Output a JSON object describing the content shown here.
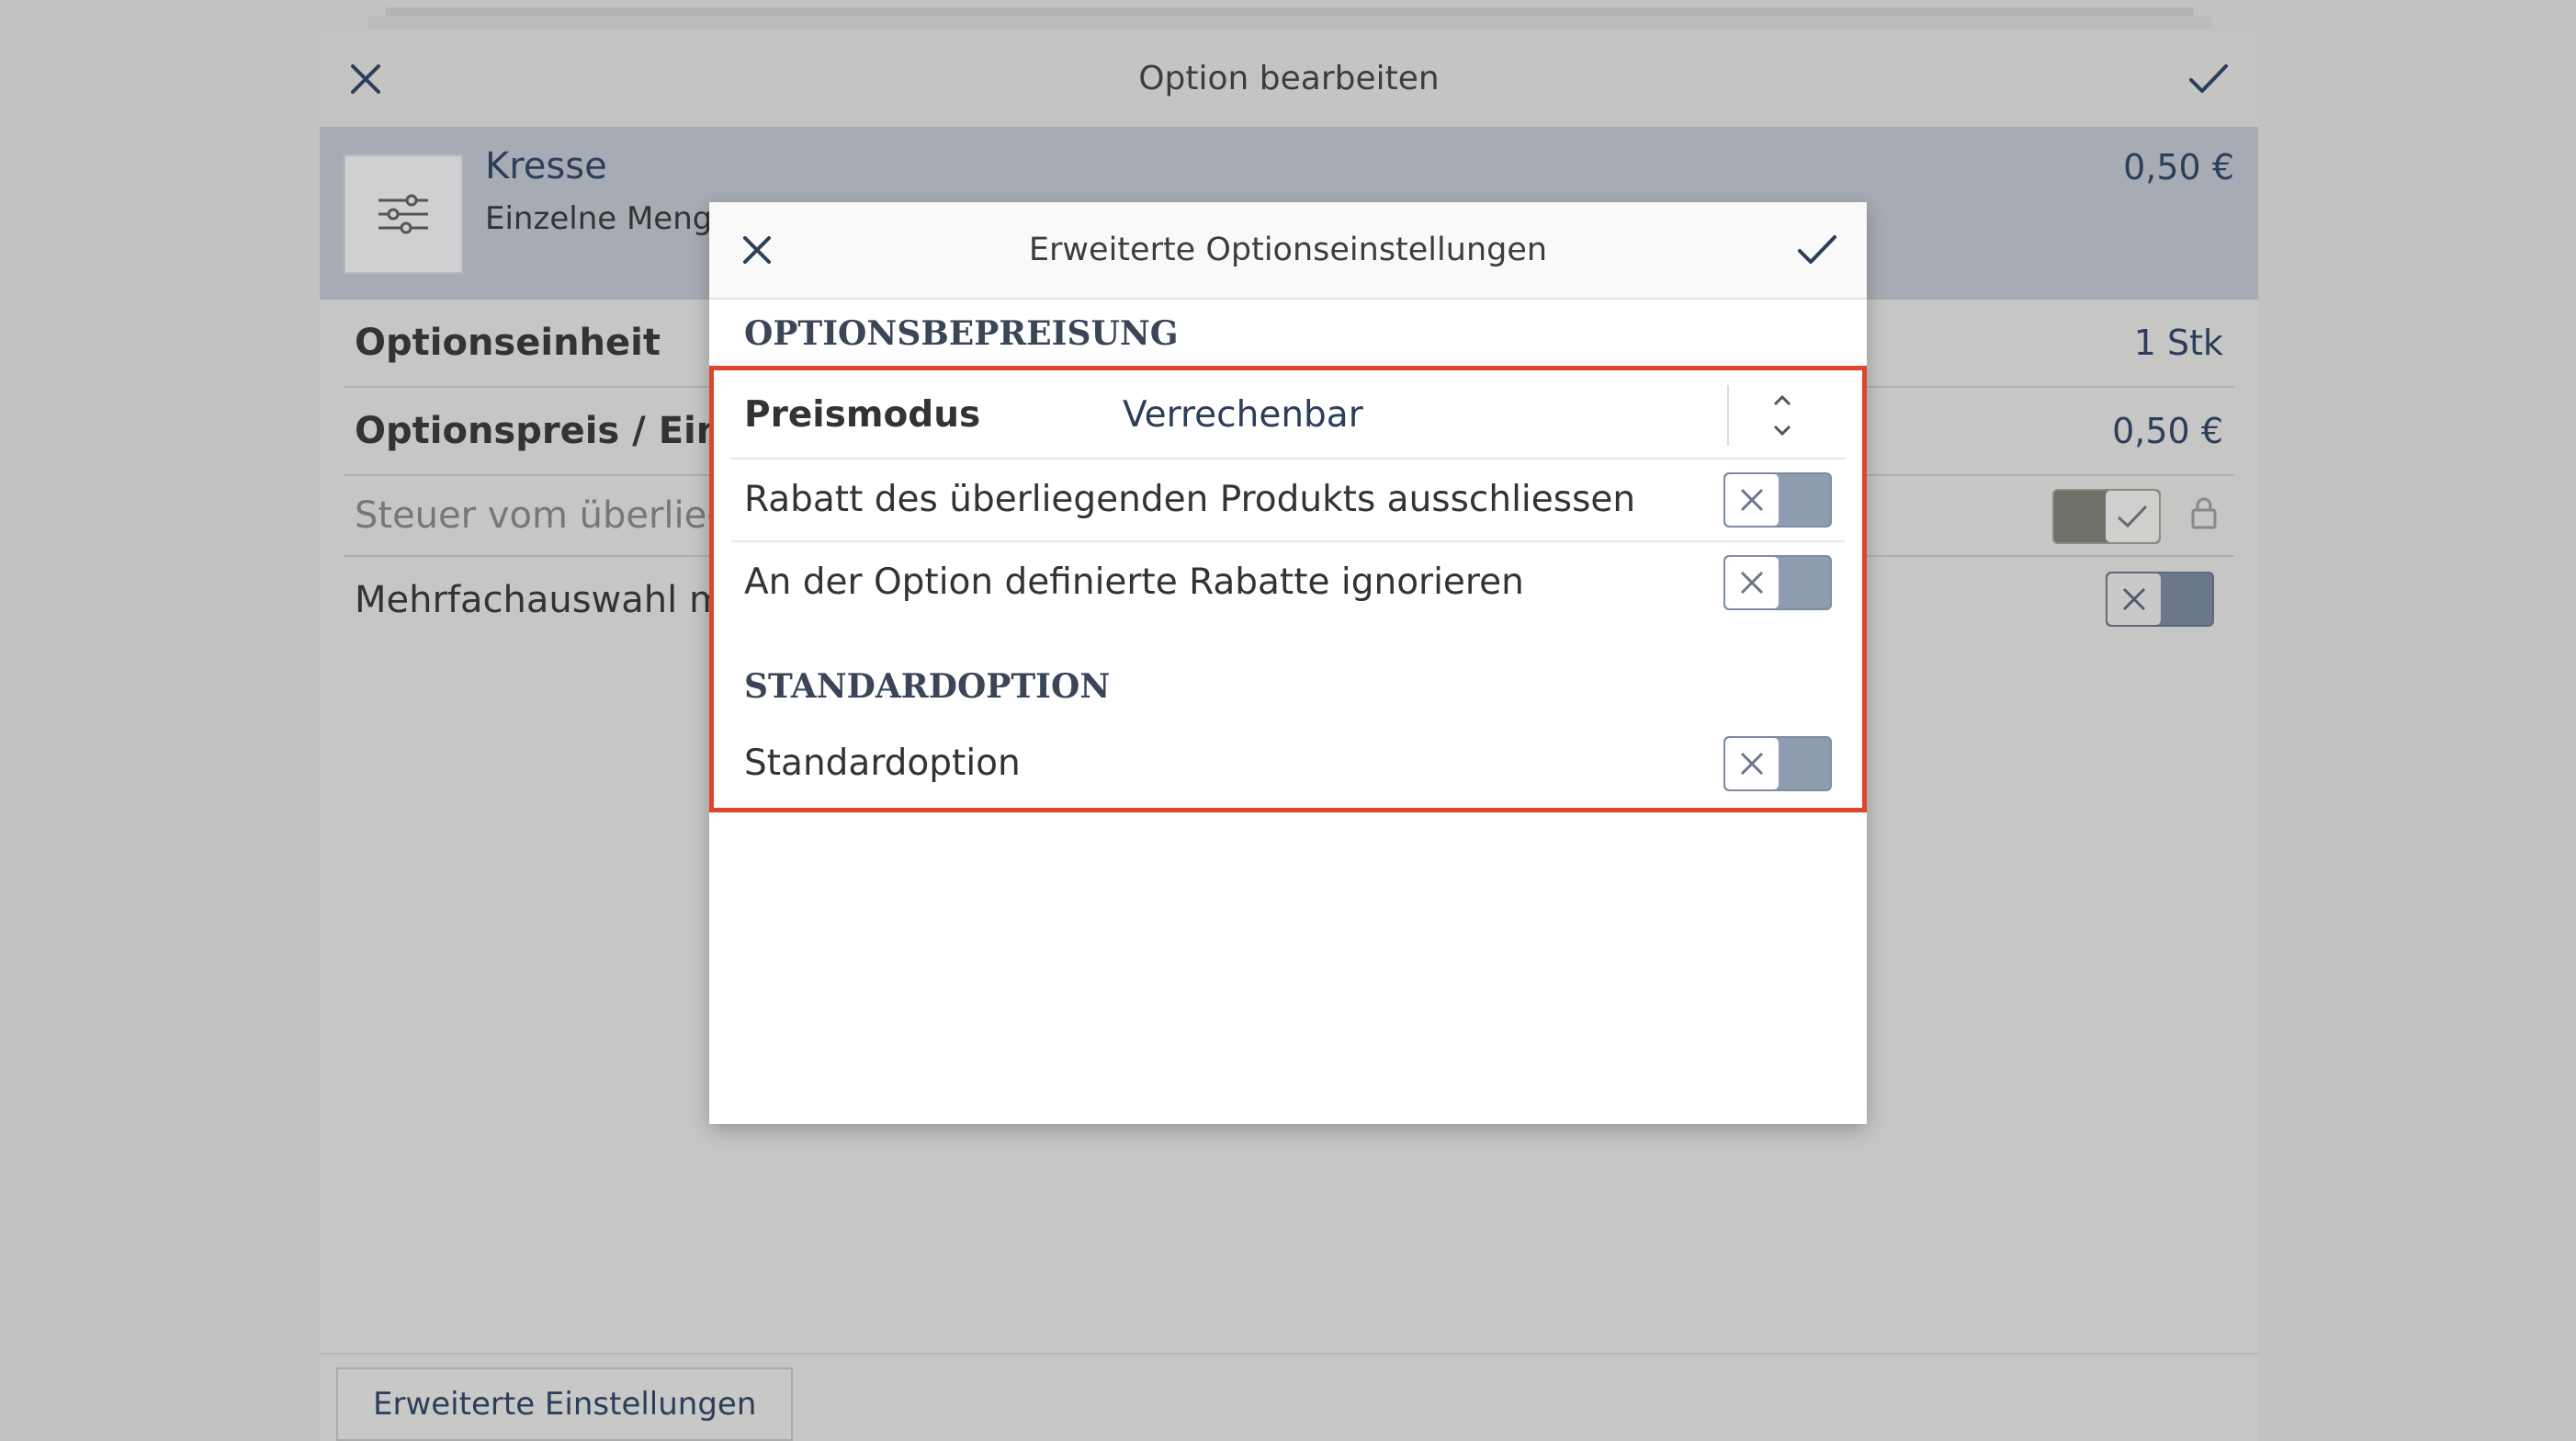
{
  "main": {
    "title": "Option bearbeiten",
    "product": {
      "name": "Kresse",
      "subtitle": "Einzelne Menge",
      "price": "0,50 €"
    },
    "rows": [
      {
        "label": "Optionseinheit",
        "value": "1 Stk"
      },
      {
        "label": "Optionspreis / Einheit",
        "value": "0,50 €"
      },
      {
        "label": "Steuer vom überliegenden Produkt übernehmen"
      },
      {
        "label": "Mehrfachauswahl möglich"
      }
    ],
    "footer_button": "Erweiterte Einstellungen"
  },
  "dialog": {
    "title": "Erweiterte Optionseinstellungen",
    "sections": [
      {
        "title": "OPTIONSBEPREISUNG"
      },
      {
        "title": "STANDARDOPTION"
      }
    ],
    "price_mode": {
      "label": "Preismodus",
      "value": "Verrechenbar"
    },
    "toggles": [
      {
        "label": "Rabatt des überliegenden Produkts ausschliessen"
      },
      {
        "label": "An der Option definierte Rabatte ignorieren"
      },
      {
        "label": "Standardoption"
      }
    ]
  },
  "colors": {
    "accent": "#2c3e5a",
    "highlight": "#e0462a",
    "toggle_off": "#8e9cb0"
  }
}
